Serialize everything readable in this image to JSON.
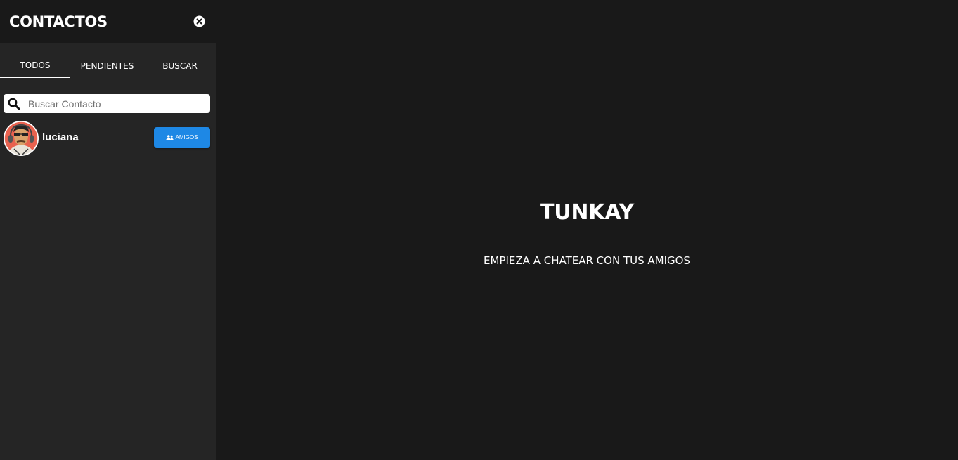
{
  "sidebar": {
    "title": "CONTACTOS",
    "close_icon": "circle-x-icon",
    "tabs": [
      {
        "label": "TODOS",
        "active": true
      },
      {
        "label": "PENDIENTES",
        "active": false
      },
      {
        "label": "BUSCAR",
        "active": false
      }
    ],
    "search": {
      "placeholder": "Buscar Contacto",
      "value": "",
      "icon": "search-icon"
    },
    "contacts": [
      {
        "name": "luciana",
        "button_label": "AMIGOS",
        "button_icon": "users-icon"
      }
    ]
  },
  "main": {
    "title": "TUNKAY",
    "subtitle": "EMPIEZA A CHATEAR CON TUS AMIGOS"
  },
  "colors": {
    "page_background": "#191919",
    "sidebar_background": "#252525",
    "accent": "#1e88e5",
    "text": "#ffffff"
  }
}
